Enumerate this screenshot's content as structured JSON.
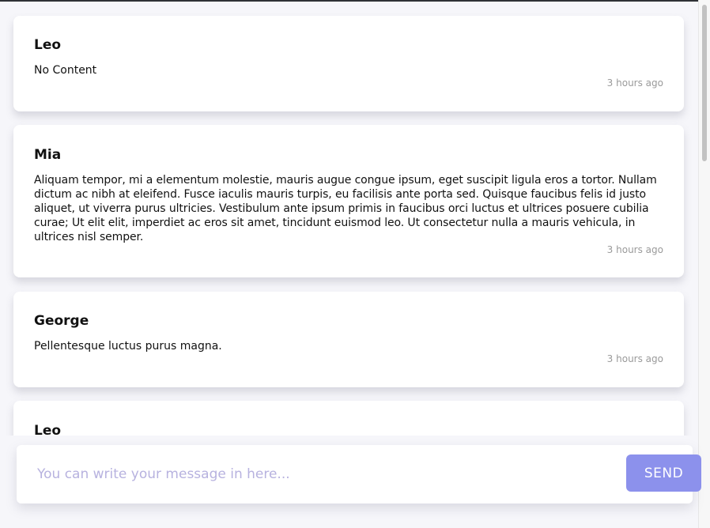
{
  "messages": [
    {
      "author": "Leo",
      "content": "No Content",
      "time": "3 hours ago"
    },
    {
      "author": "Mia",
      "content": "Aliquam tempor, mi a elementum molestie, mauris augue congue ipsum, eget suscipit ligula eros a tortor. Nullam dictum ac nibh at eleifend. Fusce iaculis mauris turpis, eu facilisis ante porta sed. Quisque faucibus felis id justo aliquet, ut viverra purus ultricies. Vestibulum ante ipsum primis in faucibus orci luctus et ultrices posuere cubilia curae; Ut elit elit, imperdiet ac eros sit amet, tincidunt euismod leo. Ut consectetur nulla a mauris vehicula, in ultrices nisl semper.",
      "time": "3 hours ago"
    },
    {
      "author": "George",
      "content": "Pellentesque luctus purus magna.",
      "time": "3 hours ago"
    },
    {
      "author": "Leo"
    }
  ],
  "composer": {
    "placeholder": "You can write your message in here...",
    "send_label": "SEND"
  },
  "colors": {
    "accent": "#8c91ec",
    "placeholder": "#b7b2df",
    "timestamp": "#9a9a9a"
  }
}
